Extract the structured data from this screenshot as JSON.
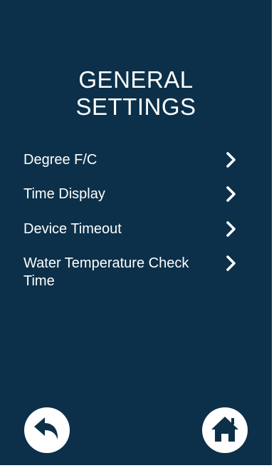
{
  "page": {
    "title_line1": "GENERAL",
    "title_line2": "SETTINGS"
  },
  "menu": {
    "items": [
      {
        "label": "Degree F/C",
        "icon": "chevron-right-icon"
      },
      {
        "label": "Time Display",
        "icon": "chevron-right-icon"
      },
      {
        "label": "Device Timeout",
        "icon": "chevron-right-icon"
      },
      {
        "label": "Water Temperature Check Time",
        "icon": "chevron-right-icon"
      }
    ]
  },
  "footer": {
    "back_icon": "back-arrow-icon",
    "home_icon": "home-icon"
  },
  "colors": {
    "background": "#0c3049",
    "text": "#ffffff",
    "button_fill": "#ffffff",
    "button_icon": "#0c3049"
  }
}
